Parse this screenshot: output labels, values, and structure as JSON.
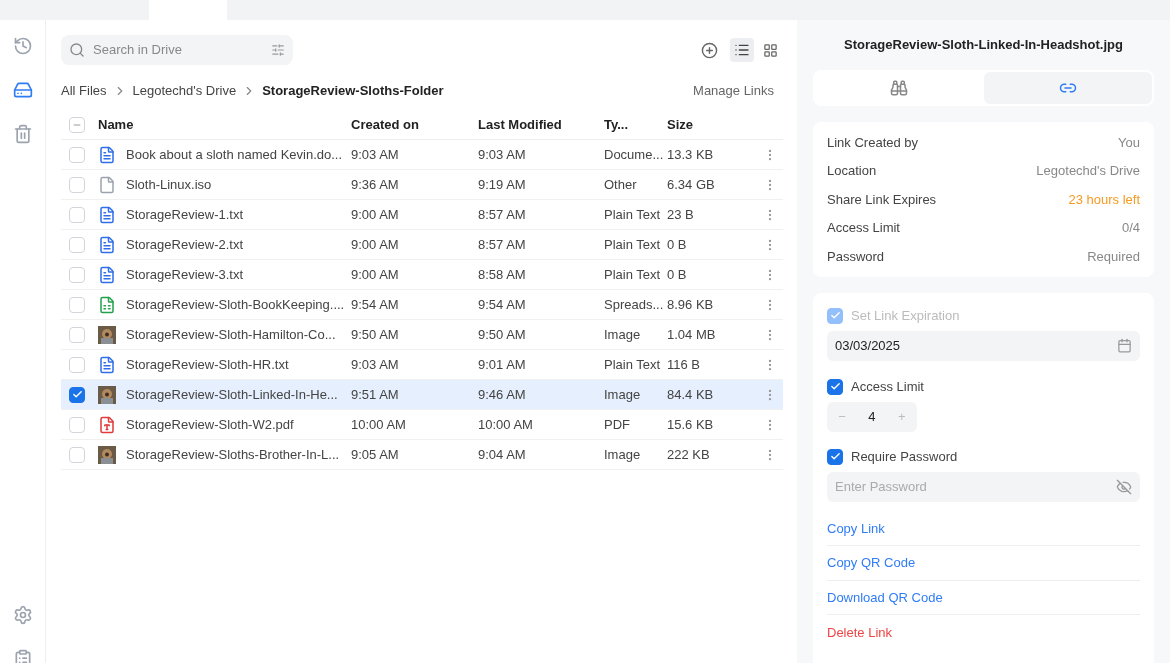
{
  "search": {
    "placeholder": "Search in Drive"
  },
  "breadcrumb": [
    "All Files",
    "Legotechd's Drive",
    "StorageReview-Sloths-Folder"
  ],
  "manage_links": "Manage Links",
  "sidebar": [
    {
      "kind": "history",
      "selected": false
    },
    {
      "kind": "drive",
      "selected": true
    },
    {
      "kind": "trash",
      "selected": false
    }
  ],
  "view": {
    "list_selected": true
  },
  "table": {
    "all_checked": false,
    "columns": [
      "Name",
      "Created on",
      "Last Modified",
      "Ty...",
      "Size"
    ],
    "rows": [
      {
        "kind": "doc",
        "name": "Book about a sloth named Kevin.do...",
        "created": "9:03 AM",
        "modified": "9:03 AM",
        "type": "Docume...",
        "size": "13.3 KB",
        "selected": false
      },
      {
        "kind": "blank",
        "name": "Sloth-Linux.iso",
        "created": "9:36 AM",
        "modified": "9:19 AM",
        "type": "Other",
        "size": "6.34 GB",
        "selected": false
      },
      {
        "kind": "txt",
        "name": "StorageReview-1.txt",
        "created": "9:00 AM",
        "modified": "8:57 AM",
        "type": "Plain Text",
        "size": "23 B",
        "selected": false
      },
      {
        "kind": "txt",
        "name": "StorageReview-2.txt",
        "created": "9:00 AM",
        "modified": "8:57 AM",
        "type": "Plain Text",
        "size": "0 B",
        "selected": false
      },
      {
        "kind": "txt",
        "name": "StorageReview-3.txt",
        "created": "9:00 AM",
        "modified": "8:58 AM",
        "type": "Plain Text",
        "size": "0 B",
        "selected": false
      },
      {
        "kind": "sheet",
        "name": "StorageReview-Sloth-BookKeeping....",
        "created": "9:54 AM",
        "modified": "9:54 AM",
        "type": "Spreads...",
        "size": "8.96 KB",
        "selected": false
      },
      {
        "name": "StorageReview-Sloth-Hamilton-Co...",
        "created": "9:50 AM",
        "modified": "9:50 AM",
        "type": "Image",
        "size": "1.04 MB",
        "selected": false
      },
      {
        "kind": "txt",
        "name": "StorageReview-Sloth-HR.txt",
        "created": "9:03 AM",
        "modified": "9:01 AM",
        "type": "Plain Text",
        "size": "116 B",
        "selected": false
      },
      {
        "name": "StorageReview-Sloth-Linked-In-He...",
        "created": "9:51 AM",
        "modified": "9:46 AM",
        "type": "Image",
        "size": "84.4 KB",
        "selected": true
      },
      {
        "kind": "pdf",
        "name": "StorageReview-Sloth-W2.pdf",
        "created": "10:00 AM",
        "modified": "10:00 AM",
        "type": "PDF",
        "size": "15.6 KB",
        "selected": false
      },
      {
        "name": "StorageReview-Sloths-Brother-In-L...",
        "created": "9:05 AM",
        "modified": "9:04 AM",
        "type": "Image",
        "size": "222 KB",
        "selected": false
      }
    ]
  },
  "panel": {
    "title": "StorageReview-Sloth-Linked-In-Headshot.jpg",
    "tabs": [
      {
        "kind": "details",
        "selected": false
      },
      {
        "kind": "link",
        "selected": true
      }
    ],
    "info": [
      {
        "label": "Link Created by",
        "value": "You",
        "warn": false
      },
      {
        "label": "Location",
        "value": "Legotechd's Drive",
        "warn": false
      },
      {
        "label": "Share Link Expires",
        "value": "23 hours left",
        "warn": true
      },
      {
        "label": "Access Limit",
        "value": "0/4",
        "warn": false
      },
      {
        "label": "Password",
        "value": "Required",
        "warn": false
      }
    ],
    "expiration": {
      "label": "Set Link Expiration",
      "checked": true,
      "disabled": true,
      "date": "03/03/2025"
    },
    "access_limit": {
      "label": "Access Limit",
      "checked": true,
      "minus": "−",
      "value": "4",
      "plus": "+"
    },
    "password": {
      "label": "Require Password",
      "checked": true,
      "placeholder": "Enter Password"
    },
    "actions": [
      {
        "label": "Copy Link",
        "danger": false
      },
      {
        "label": "Copy QR Code",
        "danger": false
      },
      {
        "label": "Download QR Code",
        "danger": false
      },
      {
        "label": "Delete Link",
        "danger": true
      }
    ]
  }
}
